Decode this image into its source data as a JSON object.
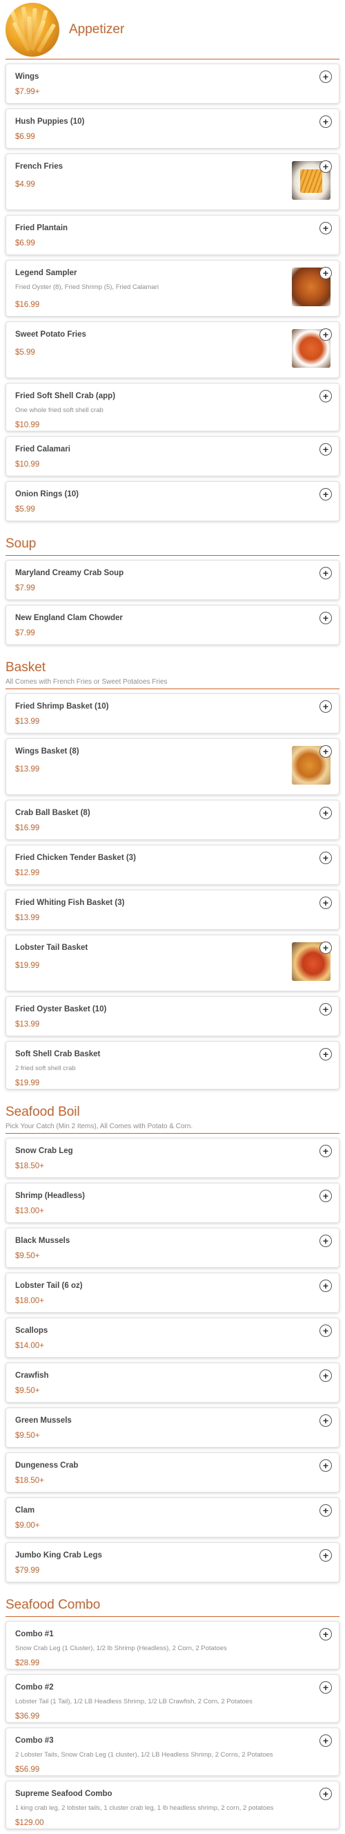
{
  "sections": [
    {
      "title": "Appetizer",
      "subtitle": "",
      "image_icon": "french-fries-photo",
      "items": [
        {
          "name": "Wings",
          "desc": "",
          "price": "$7.99+",
          "image": ""
        },
        {
          "name": "Hush Puppies (10)",
          "desc": "",
          "price": "$6.99",
          "image": ""
        },
        {
          "name": "French Fries",
          "desc": "",
          "price": "$4.99",
          "image": "fries"
        },
        {
          "name": "Fried Plantain",
          "desc": "",
          "price": "$6.99",
          "image": ""
        },
        {
          "name": "Legend Sampler",
          "desc": "Fried Oyster (8), Fried Shrimp (5), Fried Calamari",
          "price": "$16.99",
          "image": "sampler"
        },
        {
          "name": "Sweet Potato Fries",
          "desc": "",
          "price": "$5.99",
          "image": "sweet"
        },
        {
          "name": "Fried Soft Shell Crab (app)",
          "desc": "One whole fried soft shell crab",
          "price": "$10.99",
          "image": ""
        },
        {
          "name": "Fried Calamari",
          "desc": "",
          "price": "$10.99",
          "image": ""
        },
        {
          "name": "Onion Rings (10)",
          "desc": "",
          "price": "$5.99",
          "image": ""
        }
      ]
    },
    {
      "title": "Soup",
      "subtitle": "",
      "image_icon": "",
      "items": [
        {
          "name": "Maryland Creamy Crab Soup",
          "desc": "",
          "price": "$7.99",
          "image": ""
        },
        {
          "name": "New England Clam Chowder",
          "desc": "",
          "price": "$7.99",
          "image": ""
        }
      ]
    },
    {
      "title": "Basket",
      "subtitle": "All Comes with French Fries or Sweet Potatoes Fries",
      "image_icon": "",
      "items": [
        {
          "name": "Fried Shrimp Basket (10)",
          "desc": "",
          "price": "$13.99",
          "image": ""
        },
        {
          "name": "Wings Basket (8)",
          "desc": "",
          "price": "$13.99",
          "image": "wings"
        },
        {
          "name": "Crab Ball Basket (8)",
          "desc": "",
          "price": "$16.99",
          "image": ""
        },
        {
          "name": "Fried Chicken Tender Basket (3)",
          "desc": "",
          "price": "$12.99",
          "image": ""
        },
        {
          "name": "Fried Whiting Fish Basket (3)",
          "desc": "",
          "price": "$13.99",
          "image": ""
        },
        {
          "name": "Lobster Tail Basket",
          "desc": "",
          "price": "$19.99",
          "image": "lobster"
        },
        {
          "name": "Fried Oyster Basket (10)",
          "desc": "",
          "price": "$13.99",
          "image": ""
        },
        {
          "name": "Soft Shell Crab Basket",
          "desc": "2 fried soft shell crab",
          "price": "$19.99",
          "image": ""
        }
      ]
    },
    {
      "title": "Seafood Boil",
      "subtitle": "Pick Your Catch (Min 2 Items), All Comes with Potato & Corn.",
      "image_icon": "",
      "items": [
        {
          "name": "Snow Crab Leg",
          "desc": "",
          "price": "$18.50+",
          "image": ""
        },
        {
          "name": "Shrimp (Headless)",
          "desc": "",
          "price": "$13.00+",
          "image": ""
        },
        {
          "name": "Black Mussels",
          "desc": "",
          "price": "$9.50+",
          "image": ""
        },
        {
          "name": "Lobster Tail (6 oz)",
          "desc": "",
          "price": "$18.00+",
          "image": ""
        },
        {
          "name": "Scallops",
          "desc": "",
          "price": "$14.00+",
          "image": ""
        },
        {
          "name": "Crawfish",
          "desc": "",
          "price": "$9.50+",
          "image": ""
        },
        {
          "name": "Green Mussels",
          "desc": "",
          "price": "$9.50+",
          "image": ""
        },
        {
          "name": "Dungeness Crab",
          "desc": "",
          "price": "$18.50+",
          "image": ""
        },
        {
          "name": "Clam",
          "desc": "",
          "price": "$9.00+",
          "image": ""
        },
        {
          "name": "Jumbo King Crab Legs",
          "desc": "",
          "price": "$79.99",
          "image": ""
        }
      ]
    },
    {
      "title": "Seafood Combo",
      "subtitle": "",
      "image_icon": "",
      "items": [
        {
          "name": "Combo #1",
          "desc": "Snow Crab Leg (1 Cluster), 1/2 lb Shrimp (Headless), 2 Corn, 2 Potatoes",
          "price": "$28.99",
          "image": ""
        },
        {
          "name": "Combo #2",
          "desc": "Lobster Tail (1 Tail), 1/2 LB Headless Shrimp, 1/2 LB Crawfish, 2 Corn, 2 Potatoes",
          "price": "$36.99",
          "image": ""
        },
        {
          "name": "Combo #3",
          "desc": "2 Lobster Tails, Snow Crab Leg (1 cluster), 1/2 LB Headless Shrimp, 2 Corns, 2 Potatoes",
          "price": "$56.99",
          "image": ""
        },
        {
          "name": "Supreme Seafood Combo",
          "desc": "1 king crab leg, 2 lobster tails, 1 cluster crab leg, 1 lb headless shrimp, 2 corn, 2 potatoes",
          "price": "$129.00",
          "image": ""
        }
      ]
    }
  ],
  "add_button_glyph": "+",
  "colors": {
    "accent": "#c9622b",
    "item_name": "#474747",
    "desc": "#8e8e8e",
    "border": "#e2e2e2"
  }
}
